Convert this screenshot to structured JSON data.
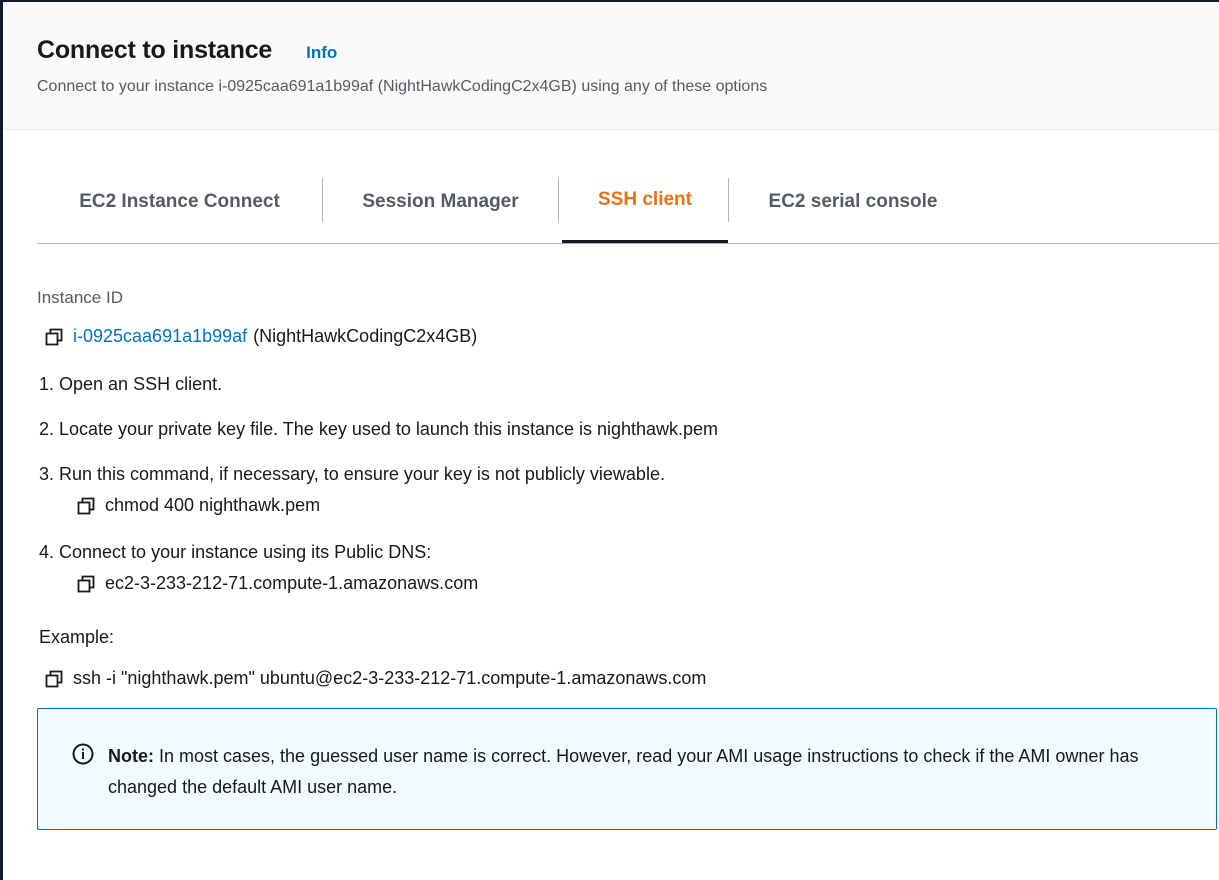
{
  "header": {
    "title": "Connect to instance",
    "info_label": "Info",
    "subtitle": "Connect to your instance i-0925caa691a1b99af (NightHawkCodingC2x4GB) using any of these options"
  },
  "tabs": [
    {
      "label": "EC2 Instance Connect",
      "active": false
    },
    {
      "label": "Session Manager",
      "active": false
    },
    {
      "label": "SSH client",
      "active": true
    },
    {
      "label": "EC2 serial console",
      "active": false
    }
  ],
  "instance": {
    "label": "Instance ID",
    "id": "i-0925caa691a1b99af",
    "name": "(NightHawkCodingC2x4GB)"
  },
  "steps": [
    {
      "text": "1. Open an SSH client."
    },
    {
      "text": "2. Locate your private key file. The key used to launch this instance is nighthawk.pem"
    },
    {
      "text": "3. Run this command, if necessary, to ensure your key is not publicly viewable.",
      "code": "chmod 400 nighthawk.pem"
    },
    {
      "text": "4. Connect to your instance using its Public DNS:",
      "code": "ec2-3-233-212-71.compute-1.amazonaws.com"
    }
  ],
  "example": {
    "label": "Example:",
    "command": "ssh -i \"nighthawk.pem\" ubuntu@ec2-3-233-212-71.compute-1.amazonaws.com"
  },
  "note": {
    "prefix": "Note:",
    "text": " In most cases, the guessed user name is correct. However, read your AMI usage instructions to check if the AMI owner has changed the default AMI user name."
  },
  "colors": {
    "accent_orange": "#ec7211",
    "link_blue": "#0073bb",
    "note_bg": "#f1faff",
    "text_dark": "#16191f",
    "text_muted": "#545b64"
  },
  "icons": {
    "copy": "copy-icon",
    "info": "info-circle-icon"
  }
}
